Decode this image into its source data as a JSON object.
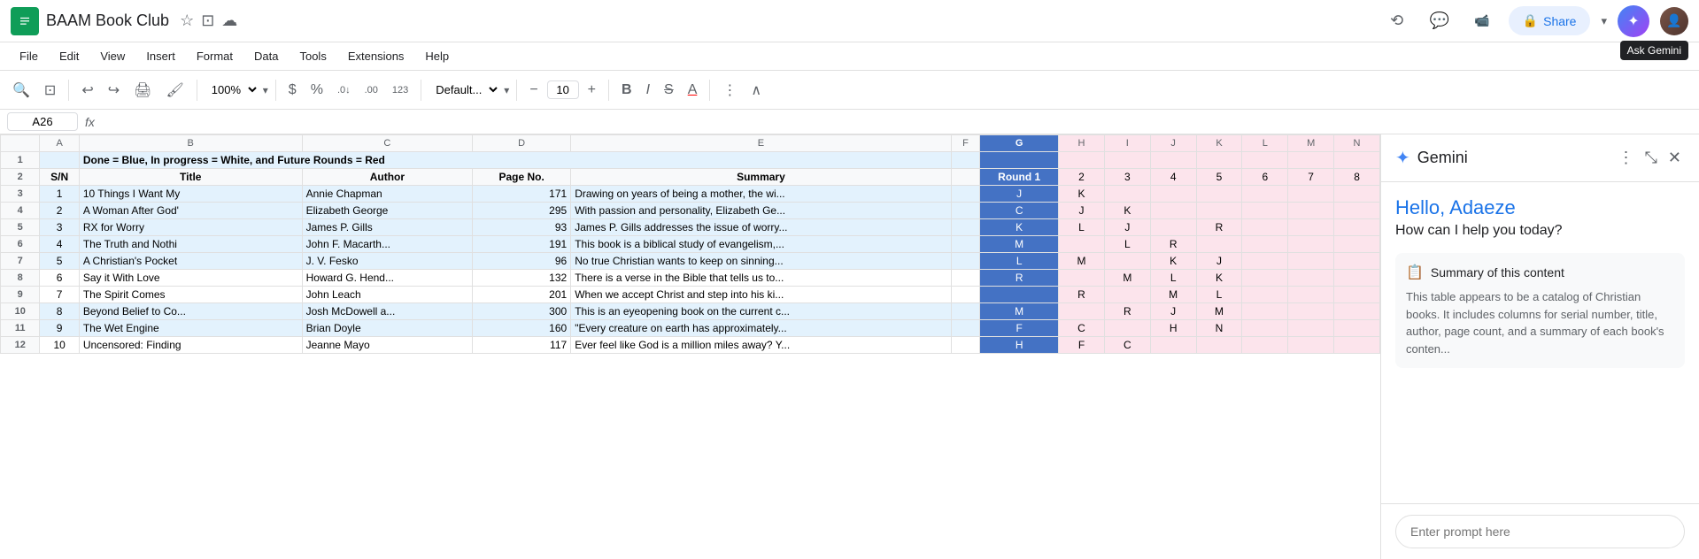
{
  "app": {
    "icon_color": "#0f9d58",
    "title": "BAAM Book Club"
  },
  "menu": {
    "items": [
      "File",
      "Edit",
      "View",
      "Insert",
      "Format",
      "Data",
      "Tools",
      "Extensions",
      "Help"
    ]
  },
  "toolbar": {
    "zoom": "100%",
    "font": "Default...",
    "font_size": "10",
    "currency": "$",
    "percent": "%"
  },
  "formula_bar": {
    "cell_ref": "A26",
    "formula_icon": "fx"
  },
  "spreadsheet": {
    "col_headers": [
      "",
      "A",
      "B",
      "C",
      "D",
      "E",
      "F",
      "G",
      "H",
      "I",
      "J",
      "K",
      "L",
      "M",
      "N"
    ],
    "row_numbers": [
      1,
      2,
      3,
      4,
      5,
      6,
      7,
      8,
      9,
      10,
      11,
      12
    ],
    "rows": [
      {
        "sn": "",
        "title": "Done = Blue, In progress = White, and Future Rounds = Red",
        "author": "",
        "page": "",
        "summary": "",
        "f": "",
        "round1": "",
        "h": "",
        "i": "",
        "j": "",
        "k": "",
        "l": "",
        "m": "",
        "n": ""
      },
      {
        "sn": "S/N",
        "title": "Title",
        "author": "Author",
        "page": "Page No.",
        "summary": "Summary",
        "f": "",
        "round1": "Round 1",
        "h": "2",
        "i": "3",
        "j": "4",
        "k": "5",
        "l": "6",
        "m": "7",
        "n": "8"
      },
      {
        "sn": "1",
        "title": "10 Things I Want My",
        "author": "Annie Chapman",
        "page": "171",
        "summary": "Drawing on years of being a mother, the wi...",
        "f": "",
        "round1": "J",
        "h": "K",
        "i": "",
        "j": "",
        "k": "",
        "l": "",
        "m": "",
        "n": ""
      },
      {
        "sn": "2",
        "title": "A Woman After God'",
        "author": "Elizabeth George",
        "page": "295",
        "summary": "With passion and personality, Elizabeth Ge...",
        "f": "",
        "round1": "C",
        "h": "J",
        "i": "K",
        "j": "",
        "k": "",
        "l": "",
        "m": "",
        "n": ""
      },
      {
        "sn": "3",
        "title": "RX for Worry",
        "author": "James P. Gills",
        "page": "93",
        "summary": "James P. Gills addresses the issue of worry...",
        "f": "",
        "round1": "K",
        "h": "L",
        "i": "J",
        "j": "",
        "k": "R",
        "l": "",
        "m": "",
        "n": ""
      },
      {
        "sn": "4",
        "title": "The Truth and Nothi",
        "author": "John F. Macarth...",
        "page": "191",
        "summary": "This book is a biblical study of evangelism,...",
        "f": "",
        "round1": "M",
        "h": "",
        "i": "L",
        "j": "R",
        "k": "",
        "l": "",
        "m": "",
        "n": ""
      },
      {
        "sn": "5",
        "title": "A Christian's Pocket",
        "author": "J. V. Fesko",
        "page": "96",
        "summary": "No true Christian wants to keep on sinning...",
        "f": "",
        "round1": "L",
        "h": "M",
        "i": "",
        "j": "K",
        "k": "J",
        "l": "",
        "m": "",
        "n": ""
      },
      {
        "sn": "6",
        "title": "Say it With Love",
        "author": "Howard G. Hend...",
        "page": "132",
        "summary": "There is a verse in the Bible that tells us to...",
        "f": "",
        "round1": "R",
        "h": "",
        "i": "M",
        "j": "L",
        "k": "K",
        "l": "",
        "m": "",
        "n": ""
      },
      {
        "sn": "7",
        "title": "The Spirit Comes",
        "author": "John Leach",
        "page": "201",
        "summary": "When we accept Christ and step into his ki...",
        "f": "",
        "round1": "",
        "h": "R",
        "i": "",
        "j": "M",
        "k": "L",
        "l": "",
        "m": "",
        "n": ""
      },
      {
        "sn": "8",
        "title": "Beyond Belief to Co...",
        "author": "Josh McDowell a...",
        "page": "300",
        "summary": "This is an eyeopening book on the current c...",
        "f": "",
        "round1": "M",
        "h": "",
        "i": "R",
        "j": "J",
        "k": "M",
        "l": "",
        "m": "",
        "n": ""
      },
      {
        "sn": "9",
        "title": "The Wet Engine",
        "author": "Brian Doyle",
        "page": "160",
        "summary": "\"Every creature on earth has approximately...",
        "f": "",
        "round1": "F",
        "h": "C",
        "i": "",
        "j": "H",
        "k": "N",
        "l": "",
        "m": "",
        "n": ""
      },
      {
        "sn": "10",
        "title": "Uncensored: Finding",
        "author": "Jeanne Mayo",
        "page": "117",
        "summary": "Ever feel like God is a million miles away? Y...",
        "f": "",
        "round1": "H",
        "h": "F",
        "i": "C",
        "j": "",
        "k": "",
        "l": "",
        "m": "",
        "n": ""
      }
    ]
  },
  "gemini": {
    "title": "Gemini",
    "greeting_name": "Hello, Adaeze",
    "greeting_sub": "How can I help you today?",
    "summary_header": "Summary of this content",
    "summary_text": "This table appears to be a catalog of Christian books. It includes columns for serial number, title, author, page count, and a summary of each book's conten...",
    "input_placeholder": "Enter prompt here"
  },
  "share": {
    "label": "Share"
  },
  "ask_gemini_tooltip": "Ask Gemini"
}
